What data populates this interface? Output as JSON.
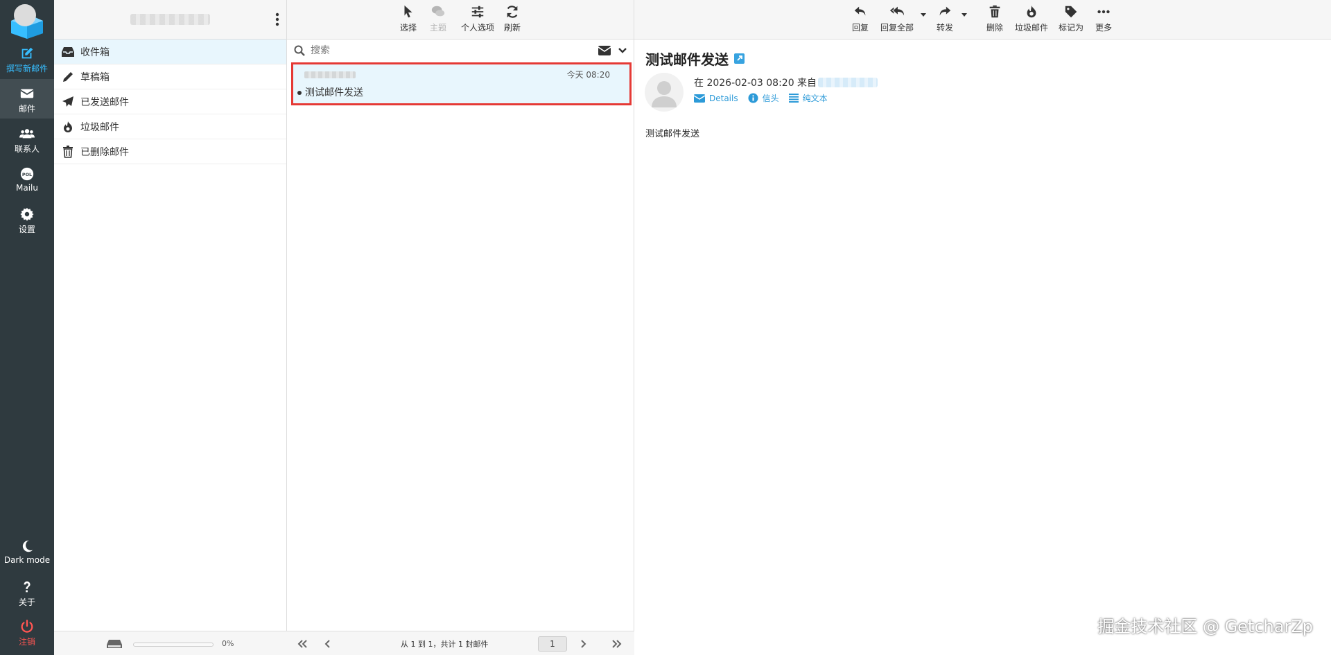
{
  "rail": {
    "compose": "撰写新邮件",
    "mail": "邮件",
    "contacts": "联系人",
    "mailu": "Mailu",
    "settings": "设置",
    "dark_mode": "Dark mode",
    "about": "关于",
    "logout": "注销"
  },
  "folders": {
    "items": [
      {
        "label": "收件箱",
        "icon": "inbox-icon"
      },
      {
        "label": "草稿箱",
        "icon": "pencil-icon"
      },
      {
        "label": "已发送邮件",
        "icon": "paper-plane-icon"
      },
      {
        "label": "垃圾邮件",
        "icon": "fire-icon"
      },
      {
        "label": "已删除邮件",
        "icon": "trash-icon"
      }
    ],
    "quota_percent": "0%",
    "quota_fraction": 0
  },
  "list_toolbar": {
    "select": "选择",
    "threads": "主题",
    "options": "个人选项",
    "refresh": "刷新"
  },
  "search": {
    "placeholder": "搜索"
  },
  "message": {
    "date": "今天 08:20",
    "subject": "测试邮件发送"
  },
  "pagination": {
    "text": "从 1 到 1，共计 1 封邮件",
    "page": "1"
  },
  "reader_toolbar": {
    "reply": "回复",
    "reply_all": "回复全部",
    "forward": "转发",
    "delete": "删除",
    "junk": "垃圾邮件",
    "mark": "标记为",
    "more": "更多"
  },
  "reader": {
    "subject": "测试邮件发送",
    "meta_prefix": "在 2026-02-03 08:20 来自",
    "links": {
      "details": "Details",
      "headers": "信头",
      "plain": "纯文本"
    },
    "body": "测试邮件发送"
  },
  "watermark": "掘金技术社区 @ GetcharZp",
  "colors": {
    "accent": "#37beff",
    "rail": "#2f3a3f",
    "logout": "#ff5552",
    "highlight": "#e53935"
  }
}
